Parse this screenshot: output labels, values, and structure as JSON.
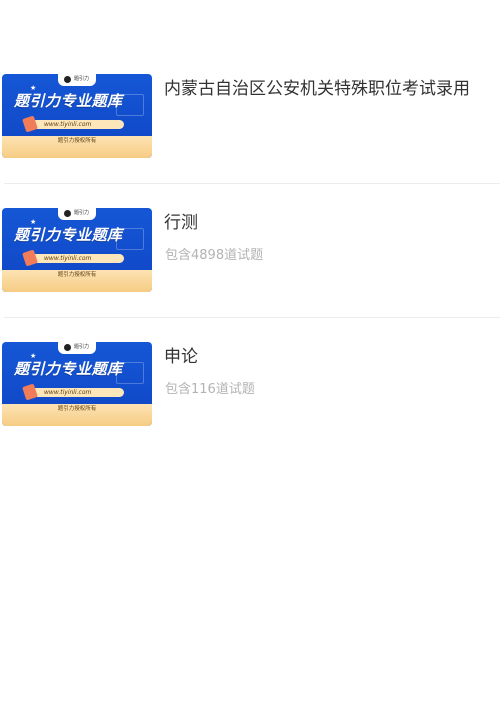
{
  "items": [
    {
      "name": "内蒙古自治区公安机关特殊职位考试录用",
      "count": "",
      "thumb": {
        "brand": "题引力",
        "title": "题引力专业题库",
        "url": "www.tiyinli.com",
        "footer": "题引力授权所有"
      }
    },
    {
      "name": "行测",
      "count": "包含4898道试题",
      "thumb": {
        "brand": "题引力",
        "title": "题引力专业题库",
        "url": "www.tiyinli.com",
        "footer": "题引力授权所有"
      }
    },
    {
      "name": "申论",
      "count": "包含116道试题",
      "thumb": {
        "brand": "题引力",
        "title": "题引力专业题库",
        "url": "www.tiyinli.com",
        "footer": "题引力授权所有"
      }
    }
  ],
  "colors": {
    "thumb_blue": "#1557d6",
    "thumb_band": "#fde3b3",
    "title_text": "#333333",
    "count_text": "#b3b3b3",
    "divider": "#ececec"
  }
}
